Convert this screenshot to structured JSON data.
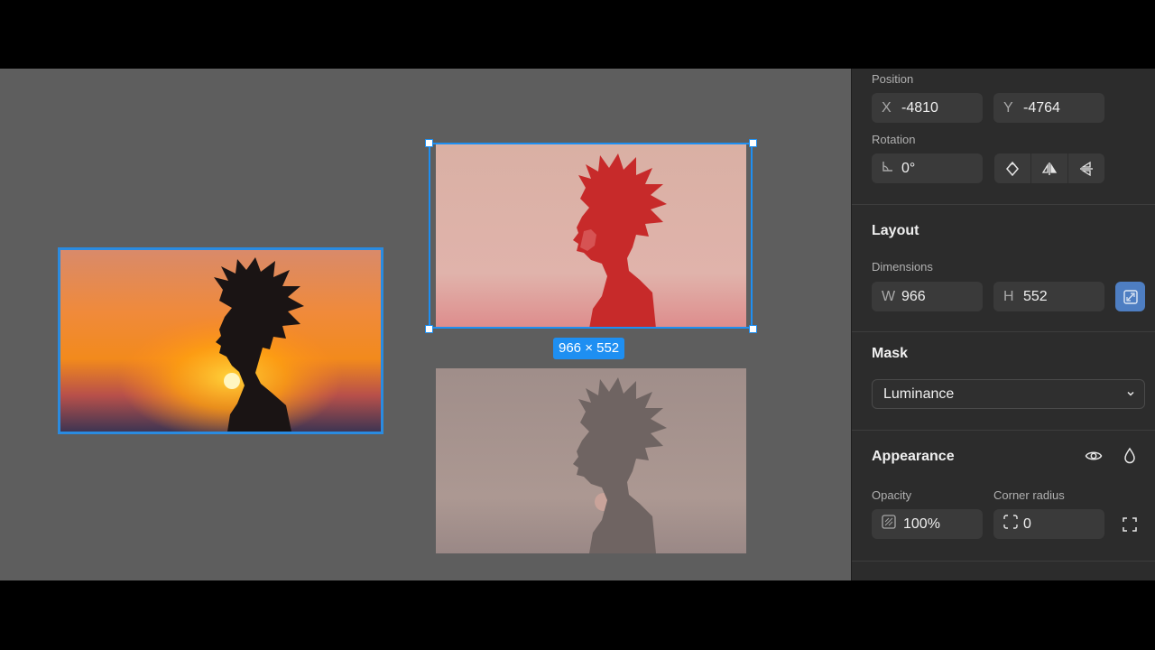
{
  "canvas": {
    "selection_badge": "966 × 552"
  },
  "panel": {
    "position": {
      "label": "Position",
      "x_prefix": "X",
      "x_value": "-4810",
      "y_prefix": "Y",
      "y_value": "-4764"
    },
    "rotation": {
      "label": "Rotation",
      "value": "0°"
    },
    "layout": {
      "title": "Layout",
      "dimensions_label": "Dimensions",
      "w_prefix": "W",
      "w_value": "966",
      "h_prefix": "H",
      "h_value": "552"
    },
    "mask": {
      "title": "Mask",
      "selected": "Luminance"
    },
    "appearance": {
      "title": "Appearance",
      "opacity_label": "Opacity",
      "opacity_value": "100%",
      "corner_radius_label": "Corner radius",
      "corner_radius_value": "0"
    }
  },
  "colors": {
    "accent": "#1e8ff2",
    "panel_bg": "#2c2c2c",
    "canvas_bg": "#5e5e5e",
    "aspect_lock_active": "#4e7ec2"
  },
  "icons": [
    "rotation-angle-icon",
    "rotate-icon",
    "flip-horizontal-icon",
    "flip-vertical-icon",
    "aspect-lock-icon",
    "chevron-down-icon",
    "eye-icon",
    "drop-icon",
    "opacity-icon",
    "corner-radius-icon",
    "independent-corners-icon"
  ]
}
